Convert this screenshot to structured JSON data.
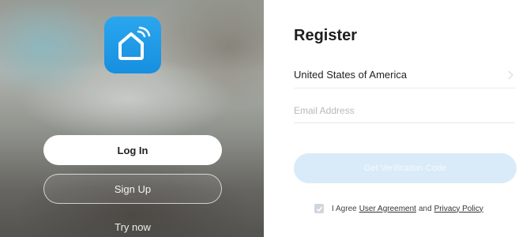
{
  "welcome": {
    "logo_icon": "smart-home-icon",
    "login_label": "Log In",
    "signup_label": "Sign Up",
    "try_now_label": "Try now",
    "accent": "#1e9be8"
  },
  "register": {
    "title": "Register",
    "country": "United States of America",
    "country_icon": "chevron-right-icon",
    "email_placeholder": "Email Address",
    "email_value": "",
    "get_code_label": "Get Verification Code",
    "agree": {
      "checked": true,
      "prefix": "I Agree",
      "user_agreement": "User Agreement",
      "conjunction": "and",
      "privacy_policy": "Privacy Policy"
    },
    "button_disabled_color": "#d9ebf8"
  }
}
